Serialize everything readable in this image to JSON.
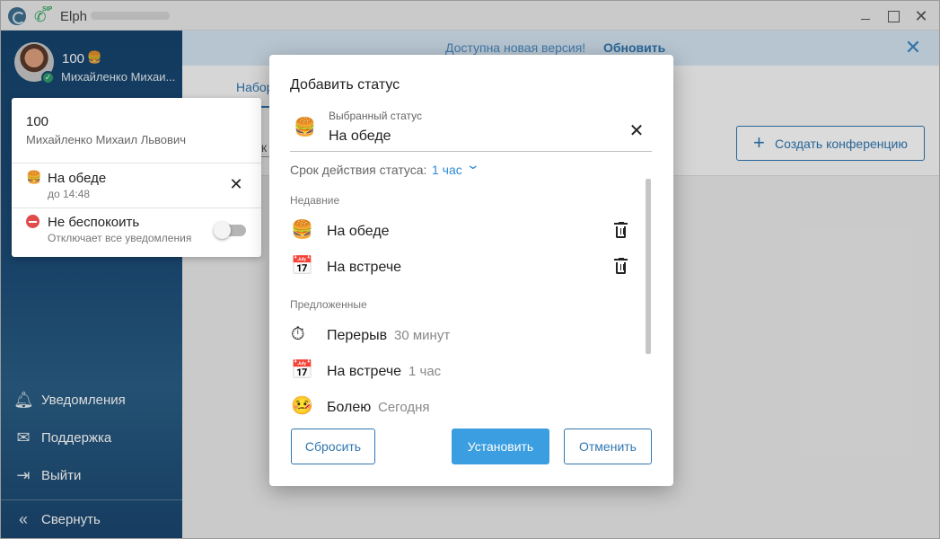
{
  "window": {
    "title": "Elph",
    "sip_badge": "SIP"
  },
  "sidebar": {
    "profile": {
      "number": "100",
      "status_emoji": "🍔",
      "name": "Михайленко Михаи..."
    },
    "items": [
      {
        "label": "Уведомления",
        "icon": "bell-icon"
      },
      {
        "label": "Поддержка",
        "icon": "mail-icon"
      },
      {
        "label": "Выйти",
        "icon": "logout-icon"
      }
    ],
    "collapse": {
      "label": "Свернуть",
      "icon": "double-chevron-left-icon"
    }
  },
  "status_panel": {
    "number": "100",
    "full_name": "Михайленко Михаил Львович",
    "current_status": {
      "emoji": "🍔",
      "label": "На обеде",
      "until": "до 14:48"
    },
    "dnd": {
      "label": "Не беспокоить",
      "description": "Отключает все уведомления",
      "enabled": false
    }
  },
  "update_banner": {
    "text": "Доступна новая версия!",
    "link": "Обновить"
  },
  "main": {
    "tab": "Набор",
    "fragment": "к",
    "create_conference": "Создать конференцию"
  },
  "dialog": {
    "title": "Добавить статус",
    "selected": {
      "label": "Выбранный статус",
      "emoji": "🍔",
      "value": "На обеде"
    },
    "duration": {
      "label": "Срок действия статуса:",
      "value": "1 час"
    },
    "recent_label": "Недавние",
    "recent": [
      {
        "emoji": "🍔",
        "label": "На обеде"
      },
      {
        "emoji": "📅",
        "label": "На встрече"
      }
    ],
    "suggested_label": "Предложенные",
    "suggested": [
      {
        "emoji": "⏱",
        "label": "Перерыв",
        "duration": "30 минут"
      },
      {
        "emoji": "📅",
        "label": "На встрече",
        "duration": "1 час"
      },
      {
        "emoji": "🤒",
        "label": "Болею",
        "duration": "Сегодня"
      }
    ],
    "buttons": {
      "reset": "Сбросить",
      "set": "Установить",
      "cancel": "Отменить"
    }
  },
  "colors": {
    "accent": "#2f77b1",
    "primary_button": "#3a9ee0",
    "sidebar": "#1c4c78"
  }
}
